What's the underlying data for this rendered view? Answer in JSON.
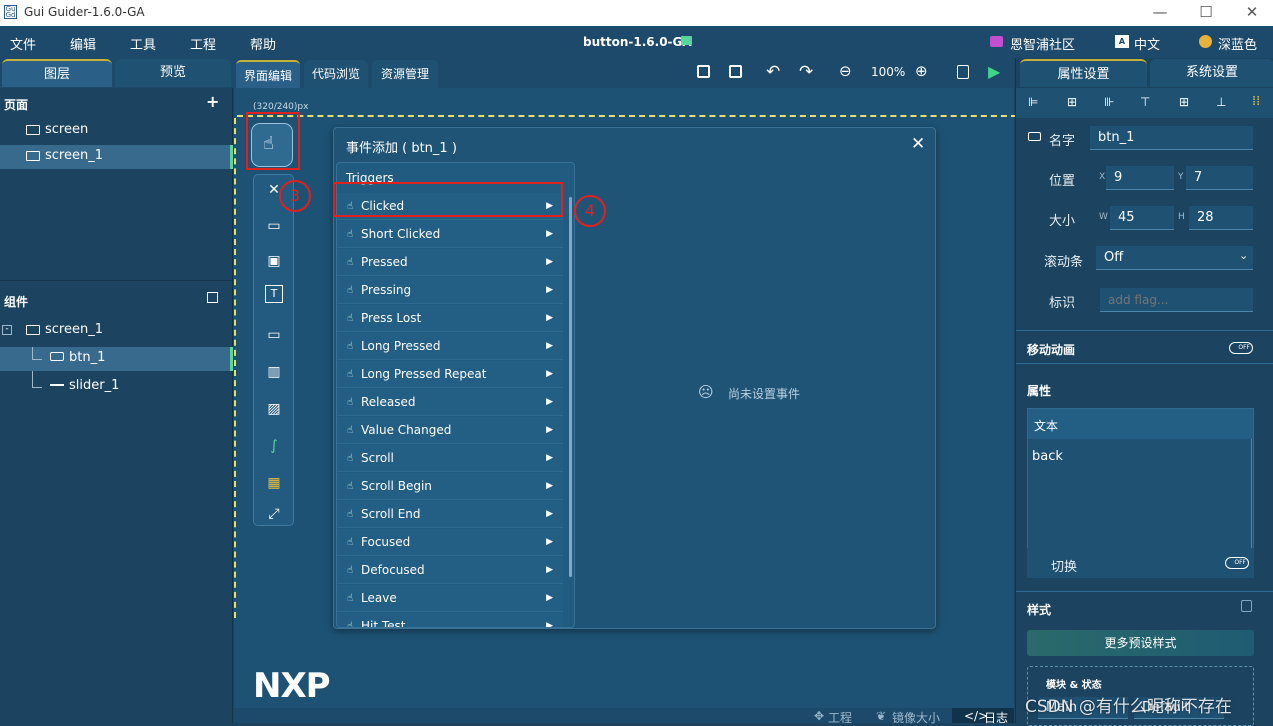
{
  "window": {
    "title": "Gui Guider-1.6.0-GA",
    "controls": [
      "—",
      "☐",
      "✕"
    ]
  },
  "menu": {
    "items": [
      "文件",
      "编辑",
      "工具",
      "工程",
      "帮助"
    ],
    "project": "button-1.6.0-GA",
    "community": "恩智浦社区",
    "language": "中文",
    "theme": "深蓝色"
  },
  "left": {
    "tabs": [
      "图层",
      "预览"
    ],
    "pages_label": "页面",
    "pages": [
      "screen",
      "screen_1"
    ],
    "components_label": "组件",
    "tree": [
      "screen_1",
      "btn_1",
      "slider_1"
    ]
  },
  "editor": {
    "tabs": [
      "界面编辑",
      "代码浏览",
      "资源管理"
    ],
    "zoom": "100%",
    "canvas_size": "(320/240)px",
    "brand": "NXP"
  },
  "dialog": {
    "title": "事件添加 ( btn_1 )",
    "close": "✕",
    "triggers_label": "Triggers",
    "triggers": [
      "Clicked",
      "Short Clicked",
      "Pressed",
      "Pressing",
      "Press Lost",
      "Long Pressed",
      "Long Pressed Repeat",
      "Released",
      "Value Changed",
      "Scroll",
      "Scroll Begin",
      "Scroll End",
      "Focused",
      "Defocused",
      "Leave",
      "Hit Test"
    ],
    "empty": "尚未设置事件"
  },
  "annotations": [
    "3",
    "4"
  ],
  "right": {
    "tabs": [
      "属性设置",
      "系统设置"
    ],
    "name_label": "名字",
    "name": "btn_1",
    "pos_label": "位置",
    "x": "9",
    "y": "7",
    "size_label": "大小",
    "w": "45",
    "h": "28",
    "scroll_label": "滚动条",
    "scroll": "Off",
    "flag_label": "标识",
    "flag_placeholder": "add flag...",
    "anim_label": "移动动画",
    "props_label": "属性",
    "text_label": "文本",
    "text_value": "back",
    "toggle_label": "切换",
    "style_label": "样式",
    "preset_btn": "更多预设样式",
    "module_label": "模块 & 状态",
    "module_value": "Main",
    "state_value": "Default",
    "off": "OFF"
  },
  "status": {
    "items": [
      "工程",
      "镜像大小",
      "日志"
    ]
  },
  "watermark": "CSDN @有什么昵称不存在"
}
